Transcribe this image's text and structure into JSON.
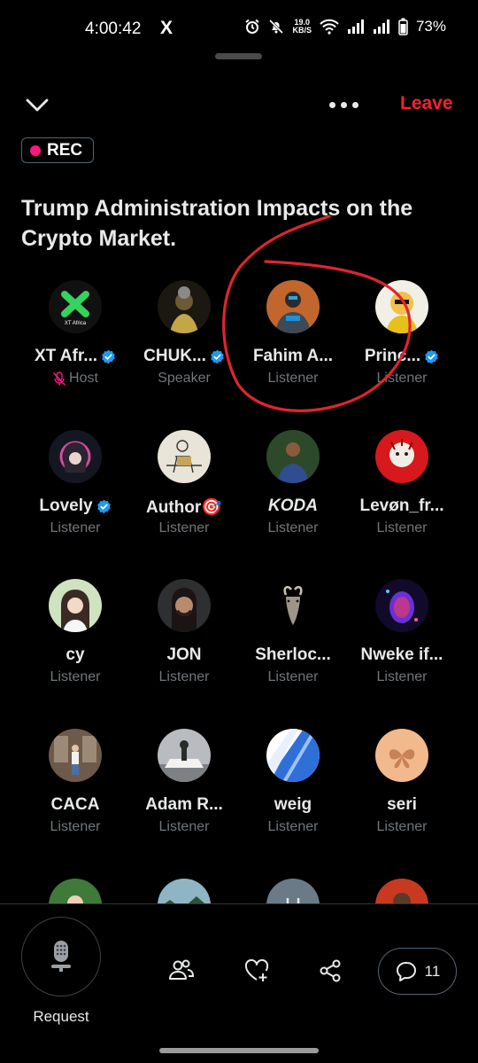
{
  "status_bar": {
    "time": "4:00:42",
    "app_icon": "X",
    "speed_value": "19.0",
    "speed_unit": "KB/S",
    "battery": "73%"
  },
  "header": {
    "leave_label": "Leave",
    "rec_label": "REC",
    "title": "Trump Administration Impacts on the Crypto Market."
  },
  "participants": [
    {
      "name": "XT Afr...",
      "role": "Host",
      "verified": true,
      "muted": true,
      "avatar": "xt-logo"
    },
    {
      "name": "CHUK...",
      "role": "Speaker",
      "verified": true,
      "avatar": "character"
    },
    {
      "name": "Fahim A...",
      "role": "Listener",
      "verified": false,
      "avatar": "robot-armor"
    },
    {
      "name": "Princ...",
      "role": "Listener",
      "verified": true,
      "avatar": "cartoon"
    },
    {
      "name": "Lovely",
      "role": "Listener",
      "verified": true,
      "avatar": "anime-girl"
    },
    {
      "name": "Author🎯",
      "role": "Listener",
      "verified": false,
      "avatar": "sketch"
    },
    {
      "name": "KODA",
      "role": "Listener",
      "verified": false,
      "avatar": "person"
    },
    {
      "name": "Levøn_fr...",
      "role": "Listener",
      "verified": false,
      "avatar": "red-art"
    },
    {
      "name": "cy",
      "role": "Listener",
      "verified": false,
      "avatar": "girl"
    },
    {
      "name": "JON",
      "role": "Listener",
      "verified": false,
      "avatar": "man"
    },
    {
      "name": "Sherloc...",
      "role": "Listener",
      "verified": false,
      "avatar": "goat"
    },
    {
      "name": "Nweke if...",
      "role": "Listener",
      "verified": false,
      "avatar": "purple-egg"
    },
    {
      "name": "CACA",
      "role": "Listener",
      "verified": false,
      "avatar": "street"
    },
    {
      "name": "Adam R...",
      "role": "Listener",
      "verified": false,
      "avatar": "car"
    },
    {
      "name": "weig",
      "role": "Listener",
      "verified": false,
      "avatar": "blue-swirl"
    },
    {
      "name": "seri",
      "role": "Listener",
      "verified": false,
      "avatar": "butterfly"
    }
  ],
  "partial_row": [
    {
      "avatar": "photo-green"
    },
    {
      "avatar": "photo-landscape"
    },
    {
      "avatar": "letter",
      "letter": "H"
    },
    {
      "avatar": "photo-colorful"
    }
  ],
  "bottom_bar": {
    "request_label": "Request",
    "comment_count": "11"
  },
  "colors": {
    "leave": "#f4212e",
    "rec_dot": "#f91880",
    "verified": "#1d9bf0",
    "muted_mic": "#f91880",
    "secondary_text": "#71767b",
    "annotation": "#e0242f"
  }
}
